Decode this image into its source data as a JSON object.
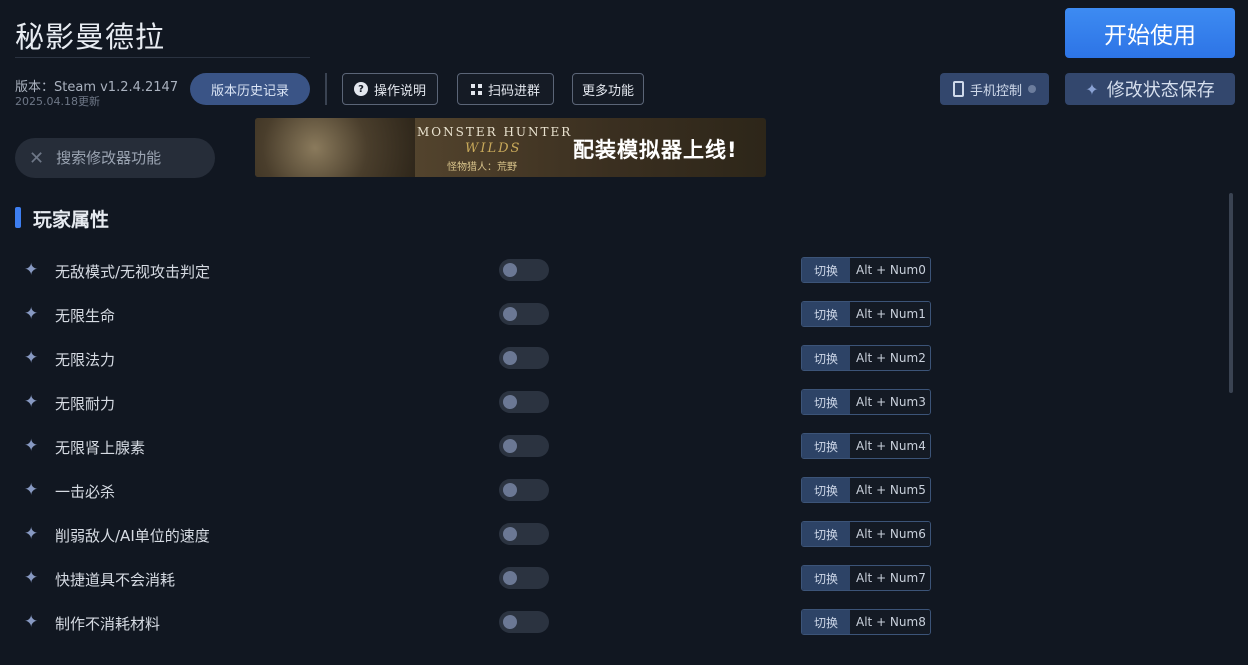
{
  "app": {
    "title": "秘影曼德拉",
    "start_label": "开始使用",
    "version_label": "版本：Steam v1.2.4.2147",
    "version_date": "2025.04.18更新"
  },
  "toolbar": {
    "history_label": "版本历史记录",
    "guide_label": "操作说明",
    "guide_icon": "question-icon",
    "scan_label": "扫码进群",
    "scan_icon": "qr-icon",
    "more_label": "更多功能",
    "phone_label": "手机控制",
    "save_label": "修改状态保存"
  },
  "search": {
    "placeholder": "搜索修改器功能"
  },
  "banner": {
    "logo_line1": "MONSTER HUNTER",
    "logo_line2": "WILDS",
    "logo_line3": "怪物猎人：荒野",
    "slogan": "配装模拟器上线!"
  },
  "section": {
    "title": "玩家属性"
  },
  "colors": {
    "accent": "#3d7ef0",
    "background": "#111721",
    "primary_button": "#2d74e6",
    "secondary_button": "#33476d"
  },
  "features": [
    {
      "label": "无敌模式/无视攻击判定",
      "action": "切换",
      "key": "Alt + Num0",
      "enabled": false
    },
    {
      "label": "无限生命",
      "action": "切换",
      "key": "Alt + Num1",
      "enabled": false
    },
    {
      "label": "无限法力",
      "action": "切换",
      "key": "Alt + Num2",
      "enabled": false
    },
    {
      "label": "无限耐力",
      "action": "切换",
      "key": "Alt + Num3",
      "enabled": false
    },
    {
      "label": "无限肾上腺素",
      "action": "切换",
      "key": "Alt + Num4",
      "enabled": false
    },
    {
      "label": "一击必杀",
      "action": "切换",
      "key": "Alt + Num5",
      "enabled": false
    },
    {
      "label": "削弱敌人/AI单位的速度",
      "action": "切换",
      "key": "Alt + Num6",
      "enabled": false
    },
    {
      "label": "快捷道具不会消耗",
      "action": "切换",
      "key": "Alt + Num7",
      "enabled": false
    },
    {
      "label": "制作不消耗材料",
      "action": "切换",
      "key": "Alt + Num8",
      "enabled": false
    }
  ]
}
